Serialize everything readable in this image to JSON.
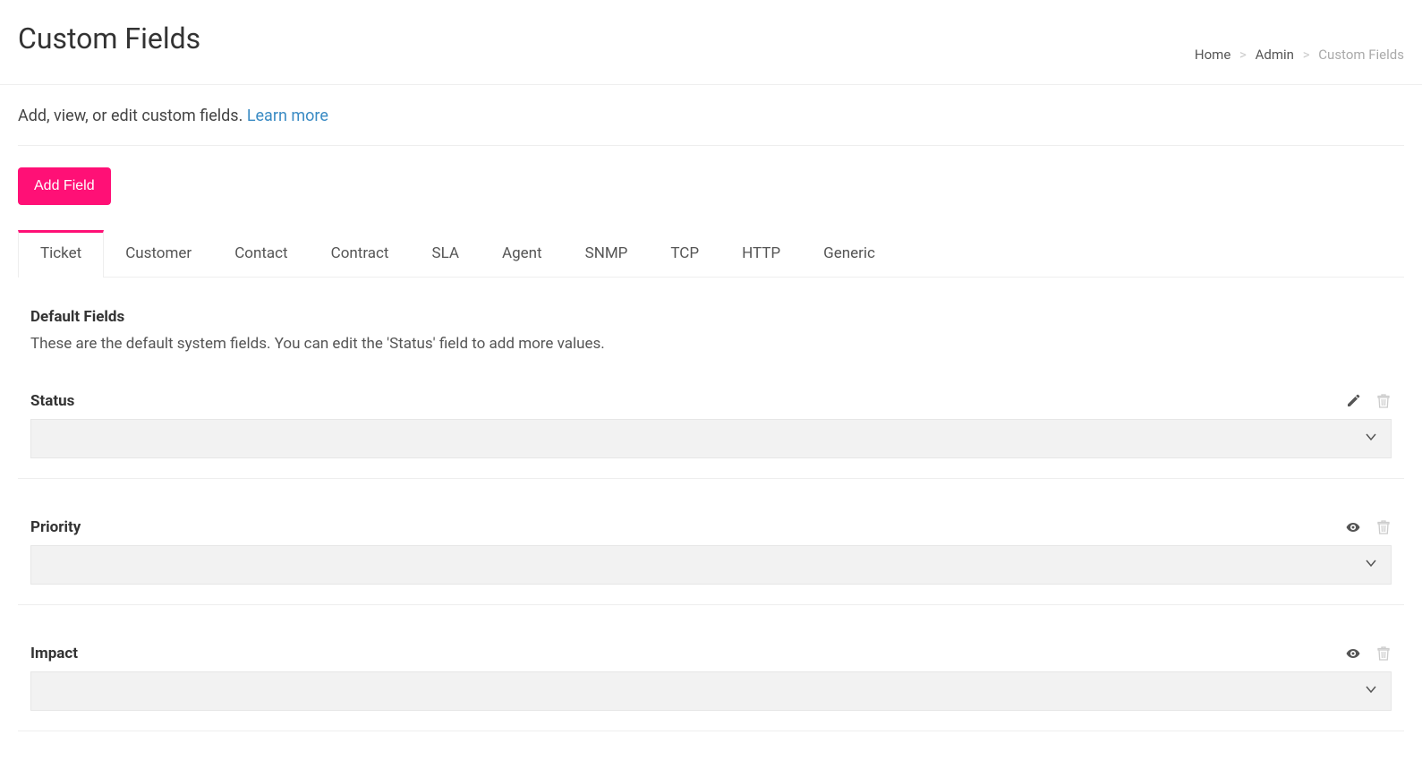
{
  "header": {
    "title": "Custom Fields",
    "breadcrumb": {
      "home": "Home",
      "admin": "Admin",
      "current": "Custom Fields"
    }
  },
  "intro": {
    "text": "Add, view, or edit custom fields. ",
    "link_text": "Learn more"
  },
  "buttons": {
    "add_field": "Add Field"
  },
  "tabs": [
    "Ticket",
    "Customer",
    "Contact",
    "Contract",
    "SLA",
    "Agent",
    "SNMP",
    "TCP",
    "HTTP",
    "Generic"
  ],
  "active_tab_index": 0,
  "section": {
    "title": "Default Fields",
    "description": "These are the default system fields. You can edit the 'Status' field to add more values."
  },
  "fields": [
    {
      "label": "Status",
      "action_icon": "pencil"
    },
    {
      "label": "Priority",
      "action_icon": "eye"
    },
    {
      "label": "Impact",
      "action_icon": "eye"
    }
  ]
}
